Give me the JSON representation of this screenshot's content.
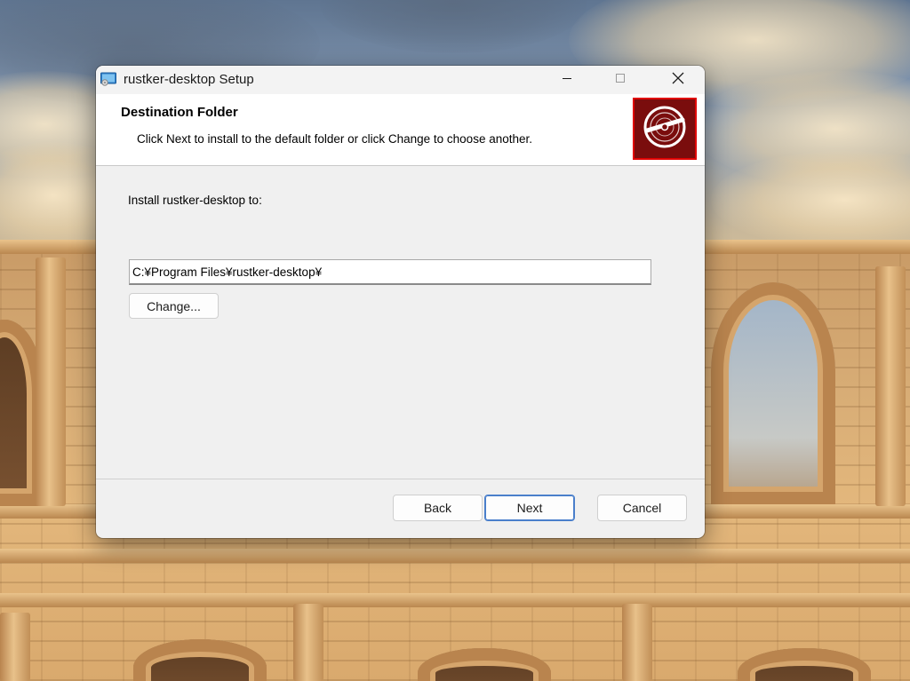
{
  "window": {
    "title": "rustker-desktop Setup",
    "controls": {
      "minimize_icon": "minimize-icon",
      "maximize_icon": "maximize-icon",
      "close_icon": "close-icon"
    }
  },
  "header": {
    "title": "Destination Folder",
    "description": "Click Next to install to the default folder or click Change to choose another.",
    "logo_icon": "disc-icon",
    "logo_color": "#7a0d0d",
    "logo_border_color": "#e00000"
  },
  "body": {
    "install_label": "Install rustker-desktop to:",
    "install_path": "C:¥Program Files¥rustker-desktop¥",
    "change_label": "Change..."
  },
  "footer": {
    "back_label": "Back",
    "next_label": "Next",
    "cancel_label": "Cancel"
  },
  "colors": {
    "accent": "#4a7fcb",
    "window_bg": "#f0f0f0",
    "header_bg": "#ffffff"
  }
}
